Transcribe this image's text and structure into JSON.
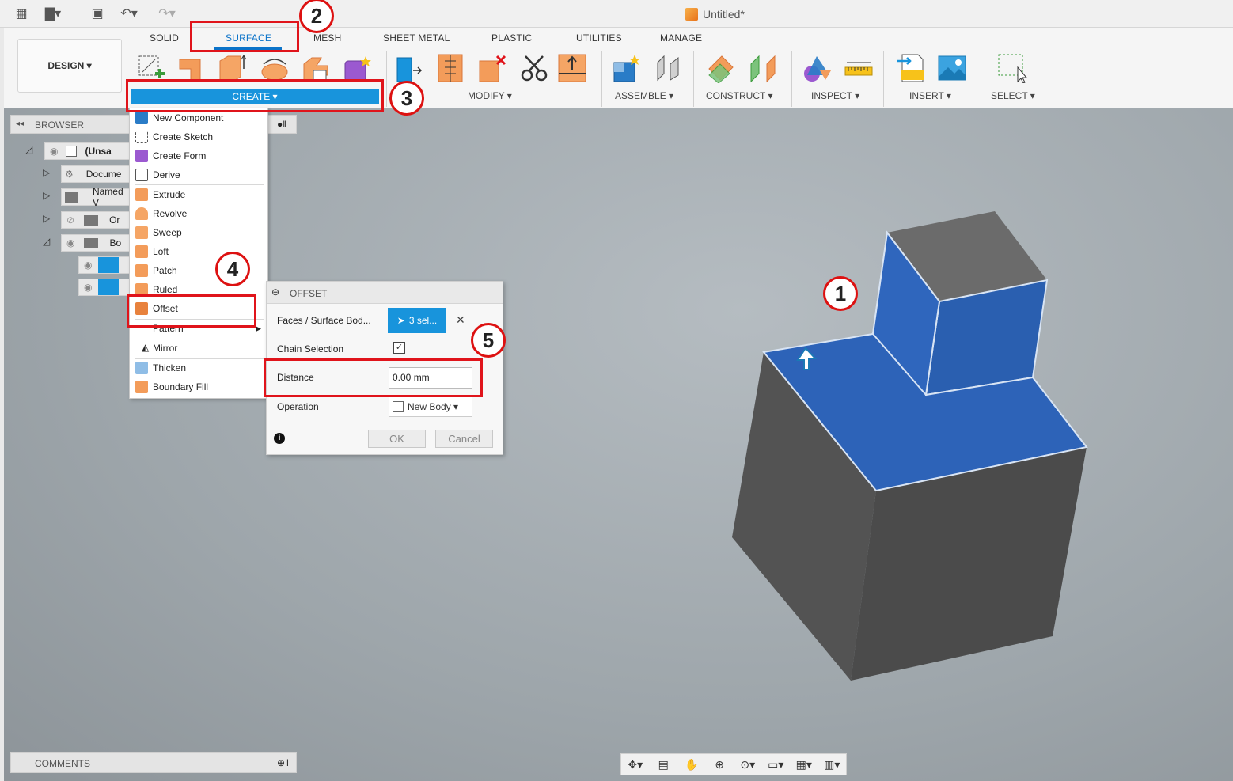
{
  "app": {
    "document_title": "Untitled*"
  },
  "tabs": [
    {
      "label": "SOLID"
    },
    {
      "label": "SURFACE"
    },
    {
      "label": "MESH"
    },
    {
      "label": "SHEET METAL"
    },
    {
      "label": "PLASTIC"
    },
    {
      "label": "UTILITIES"
    },
    {
      "label": "MANAGE"
    }
  ],
  "design_button": "DESIGN ▾",
  "groups": {
    "create": "CREATE ▾",
    "modify": "MODIFY ▾",
    "assemble": "ASSEMBLE ▾",
    "construct": "CONSTRUCT ▾",
    "inspect": "INSPECT ▾",
    "insert": "INSERT ▾",
    "select": "SELECT ▾"
  },
  "browser": {
    "title": "BROWSER",
    "rows": [
      {
        "label": "(Unsa"
      },
      {
        "label": "Docume"
      },
      {
        "label": "Named V"
      },
      {
        "label": "Or"
      },
      {
        "label": "Bo"
      }
    ]
  },
  "create_menu": {
    "items": [
      {
        "label": "New Component",
        "icon": "new-component-icon"
      },
      {
        "label": "Create Sketch",
        "icon": "create-sketch-icon"
      },
      {
        "label": "Create Form",
        "icon": "create-form-icon"
      },
      {
        "label": "Derive",
        "icon": "derive-icon"
      },
      {
        "label": "Extrude",
        "icon": "extrude-icon"
      },
      {
        "label": "Revolve",
        "icon": "revolve-icon"
      },
      {
        "label": "Sweep",
        "icon": "sweep-icon"
      },
      {
        "label": "Loft",
        "icon": "loft-icon"
      },
      {
        "label": "Patch",
        "icon": "patch-icon"
      },
      {
        "label": "Ruled",
        "icon": "ruled-icon"
      },
      {
        "label": "Offset",
        "icon": "offset-icon"
      },
      {
        "label": "Pattern",
        "icon": "pattern-icon"
      },
      {
        "label": "Mirror",
        "icon": "mirror-icon"
      },
      {
        "label": "Thicken",
        "icon": "thicken-icon"
      },
      {
        "label": "Boundary Fill",
        "icon": "boundary-fill-icon"
      }
    ]
  },
  "offset_dialog": {
    "title": "OFFSET",
    "faces_label": "Faces / Surface Bod...",
    "faces_value": "3 sel...",
    "chain_label": "Chain Selection",
    "chain_checked": "✓",
    "distance_label": "Distance",
    "distance_value": "0.00 mm",
    "operation_label": "Operation",
    "operation_value": "New Body ▾",
    "ok_label": "OK",
    "cancel_label": "Cancel",
    "info_icon": "i"
  },
  "comments": {
    "title": "COMMENTS"
  },
  "callouts": [
    "1",
    "2",
    "3",
    "4",
    "5"
  ],
  "colors": {
    "accent_blue": "#1894dc",
    "surface_tab_blue": "#0b73c9",
    "highlight_red": "#e0141b",
    "selected_face_blue": "#2d63b8",
    "body_grey": "#5d5d5d"
  }
}
